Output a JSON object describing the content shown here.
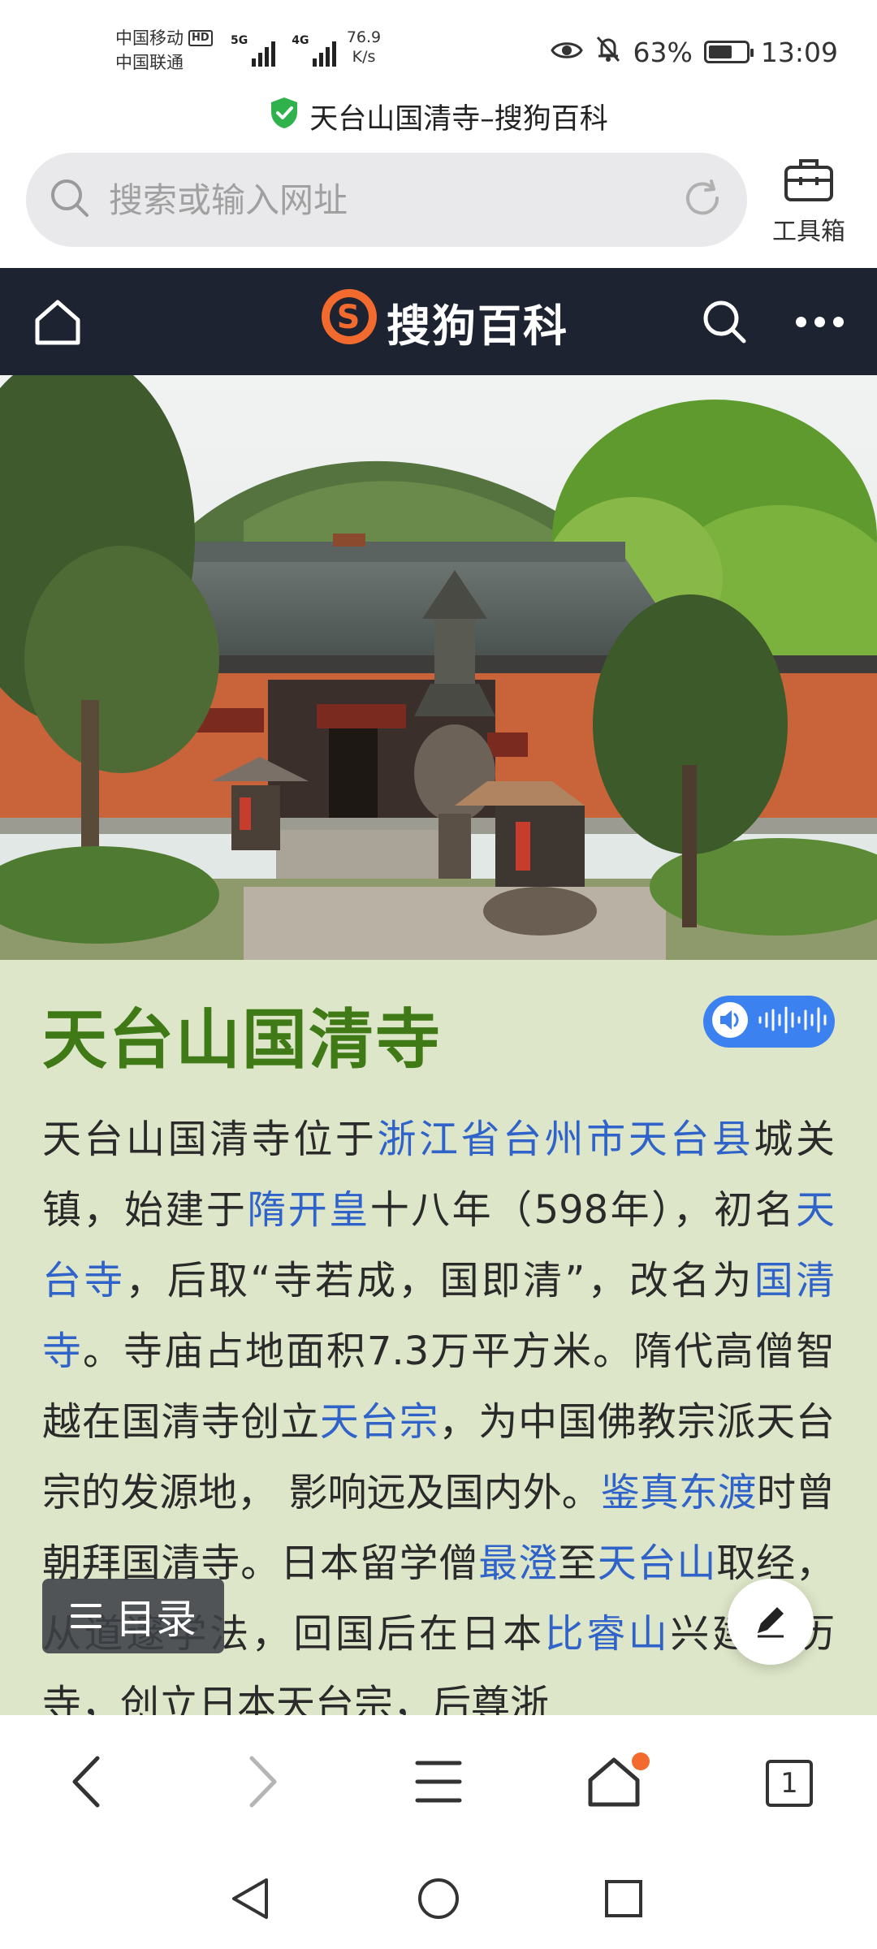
{
  "status_bar": {
    "carrier_1": "中国移动",
    "carrier_2": "中国联通",
    "hd_badge": "HD",
    "network_1": "5G",
    "network_2": "4G",
    "net_speed_value": "76.9",
    "net_speed_unit": "K/s",
    "battery_percent": "63%",
    "battery_level": 0.63,
    "time": "13:09"
  },
  "security": {
    "page_title": "天台山国清寺–搜狗百科",
    "shield_color": "#2fb24c"
  },
  "address_bar": {
    "placeholder": "搜索或输入网址",
    "toolbox_label": "工具箱"
  },
  "site_header": {
    "logo_text": "搜狗百科",
    "logo_color": "#f26a2e",
    "background": "#1d2330"
  },
  "article": {
    "title": "天台山国清寺",
    "segments": [
      {
        "text": "天台山国清寺位于",
        "link": false
      },
      {
        "text": "浙江省台州市天台县",
        "link": true
      },
      {
        "text": "城关镇，始建于",
        "link": false
      },
      {
        "text": "隋开皇",
        "link": true
      },
      {
        "text": "十八年（598年），初名",
        "link": false
      },
      {
        "text": "天台寺",
        "link": true
      },
      {
        "text": "，后取“寺若成，国即清”，改名为",
        "link": false
      },
      {
        "text": "国清寺",
        "link": true
      },
      {
        "text": "。寺庙占地面积7.3万平方米。隋代高僧智越在国清寺创立",
        "link": false
      },
      {
        "text": "天台宗",
        "link": true
      },
      {
        "text": "，为中国佛教宗派天台宗的发源地， 影响远及国内外。",
        "link": false
      },
      {
        "text": "鉴真东渡",
        "link": true
      },
      {
        "text": "时曾朝拜国清寺。日本留学僧",
        "link": false
      },
      {
        "text": "最澄",
        "link": true
      },
      {
        "text": "至",
        "link": false
      },
      {
        "text": "天台山",
        "link": true
      },
      {
        "text": "取经，从道邃学法，回国后在日本",
        "link": false
      },
      {
        "text": "比睿山",
        "link": true
      },
      {
        "text": "兴建沿历寺，创立日本天台宗，后尊浙",
        "link": false
      }
    ],
    "background": "#dde6c8",
    "title_color": "#3f7a16",
    "link_color": "#2f63c9"
  },
  "floating": {
    "toc_label": "目录"
  },
  "bottom_bar": {
    "tab_count": "1",
    "badge_color": "#f26a2e"
  }
}
